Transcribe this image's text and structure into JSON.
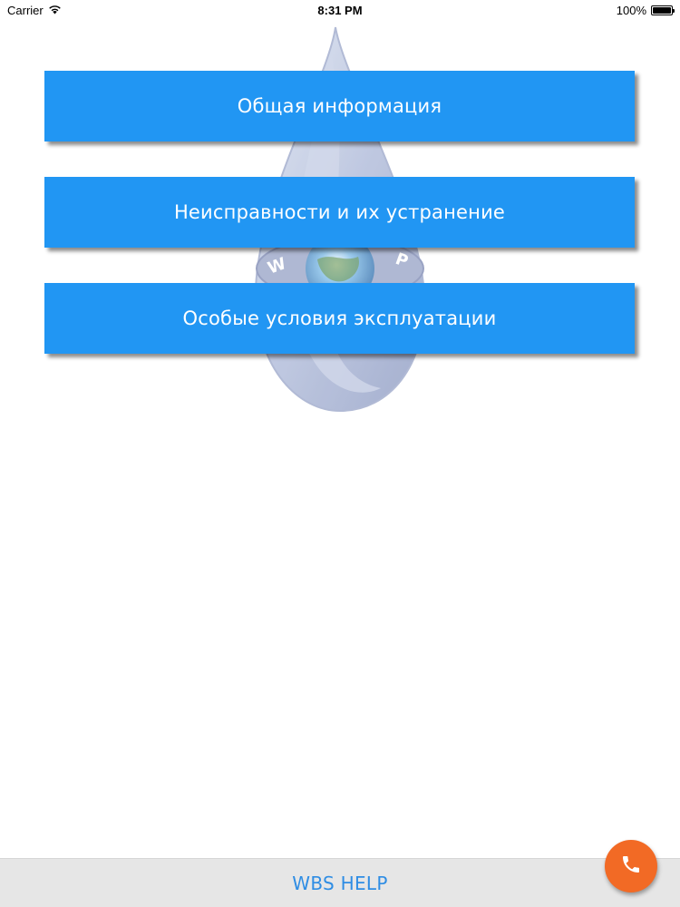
{
  "status_bar": {
    "carrier": "Carrier",
    "time": "8:31 PM",
    "battery_text": "100%",
    "battery_level": 1.0
  },
  "watermark": {
    "logo_text": "WBS GROUP"
  },
  "menu": {
    "items": [
      {
        "label": "Общая информация"
      },
      {
        "label": "Неисправности и их устранение"
      },
      {
        "label": "Особые условия эксплуатации"
      }
    ]
  },
  "bottom_bar": {
    "title": "WBS HELP"
  },
  "icons": {
    "wifi": "wifi-icon",
    "battery": "battery-icon",
    "phone": "phone-icon",
    "logo": "water-drop-logo"
  },
  "colors": {
    "primary_button": "#2196f3",
    "bottom_bar_bg": "#e6e6e6",
    "bottom_title": "#2f8de4",
    "call_button": "#f26a25"
  }
}
